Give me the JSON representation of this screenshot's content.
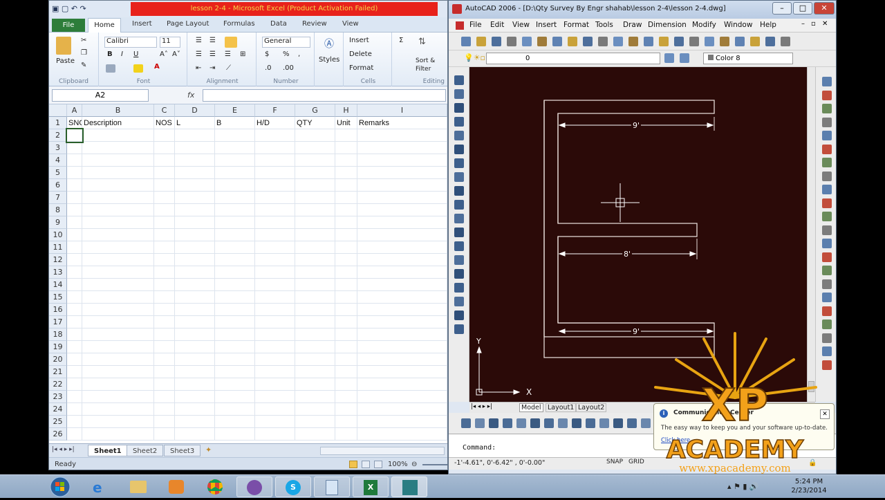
{
  "excel": {
    "title": "lesson 2-4 - Microsoft Excel (Product Activation Failed)",
    "tabs": [
      "File",
      "Home",
      "Insert",
      "Page Layout",
      "Formulas",
      "Data",
      "Review",
      "View"
    ],
    "ribbon": {
      "paste": "Paste",
      "clipboard": "Clipboard",
      "font_name": "Calibri",
      "font_size": "11",
      "font": "Font",
      "alignment": "Alignment",
      "number_format": "General",
      "number": "Number",
      "styles": "Styles",
      "insert": "Insert",
      "delete": "Delete",
      "format": "Format",
      "cells": "Cells",
      "sort_filter_1": "Sort &",
      "sort_filter_2": "Filter",
      "editing": "Editing"
    },
    "name_box": "A2",
    "fx": "fx",
    "columns": [
      "A",
      "B",
      "C",
      "D",
      "E",
      "F",
      "G",
      "H",
      "I"
    ],
    "header_row": [
      "SNO",
      "Description",
      "NOS",
      "L",
      "B",
      "H/D",
      "QTY",
      "Unit",
      "Remarks"
    ],
    "row_numbers": [
      "1",
      "2",
      "3",
      "4",
      "5",
      "6",
      "7",
      "8",
      "9",
      "10",
      "11",
      "12",
      "13",
      "14",
      "15",
      "16",
      "17",
      "18",
      "19",
      "20",
      "21",
      "22",
      "23",
      "24",
      "25",
      "26"
    ],
    "sheets": [
      "Sheet1",
      "Sheet2",
      "Sheet3"
    ],
    "status": "Ready",
    "zoom": "100%"
  },
  "autocad": {
    "title": "AutoCAD 2006 - [D:\\Qty Survey By Engr shahab\\lesson 2-4\\lesson 2-4.dwg]",
    "menu": [
      "File",
      "Edit",
      "View",
      "Insert",
      "Format",
      "Tools",
      "Draw",
      "Dimension",
      "Modify",
      "Window",
      "Help"
    ],
    "layer": "0",
    "color": "Color 8",
    "dims": [
      "9'",
      "8'",
      "9'"
    ],
    "layout_tabs": [
      "Model",
      "Layout1",
      "Layout2"
    ],
    "command": "Command:",
    "coords": "-1'-4.61\", 0'-6.42\" , 0'-0.00\"",
    "status_buttons": [
      "SNAP",
      "GRID"
    ],
    "balloon": {
      "title": "Communication Center",
      "text": "The easy way to keep you and your software up-to-date.",
      "link": "Click here"
    },
    "axis_x": "X",
    "axis_y": "Y"
  },
  "taskbar": {
    "time": "5:24 PM",
    "date": "2/23/2014"
  },
  "watermark": {
    "big": "XP",
    "small": "ACADEMY",
    "url": "www.xpacademy.com"
  }
}
